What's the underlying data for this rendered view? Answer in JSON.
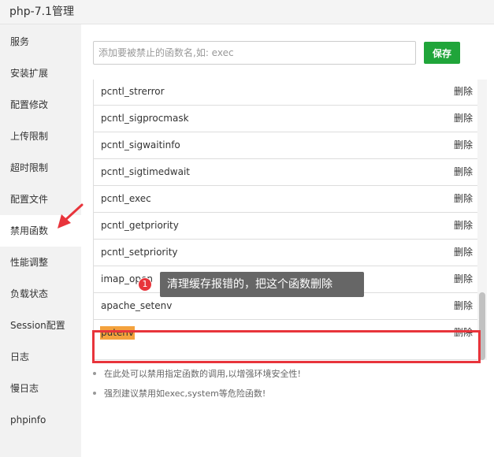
{
  "window": {
    "title": "php-7.1管理"
  },
  "sidebar": {
    "items": [
      {
        "label": "服务"
      },
      {
        "label": "安装扩展"
      },
      {
        "label": "配置修改"
      },
      {
        "label": "上传限制"
      },
      {
        "label": "超时限制"
      },
      {
        "label": "配置文件"
      },
      {
        "label": "禁用函数"
      },
      {
        "label": "性能调整"
      },
      {
        "label": "负载状态"
      },
      {
        "label": "Session配置"
      },
      {
        "label": "日志"
      },
      {
        "label": "慢日志"
      },
      {
        "label": "phpinfo"
      }
    ],
    "active_index": 6
  },
  "toolbar": {
    "input_placeholder": "添加要被禁止的函数名,如: exec",
    "input_value": "",
    "save_label": "保存"
  },
  "functions": {
    "delete_label": "删除",
    "rows": [
      {
        "name": "pcntl_strerror"
      },
      {
        "name": "pcntl_sigprocmask"
      },
      {
        "name": "pcntl_sigwaitinfo"
      },
      {
        "name": "pcntl_sigtimedwait"
      },
      {
        "name": "pcntl_exec"
      },
      {
        "name": "pcntl_getpriority"
      },
      {
        "name": "pcntl_setpriority"
      },
      {
        "name": "imap_open"
      },
      {
        "name": "apache_setenv"
      },
      {
        "name": "putenv"
      }
    ],
    "highlighted_index": 9
  },
  "annotation": {
    "number": "1",
    "text": "清理缓存报错的，把这个函数删除",
    "color": "#e8343b"
  },
  "notes": [
    "在此处可以禁用指定函数的调用,以增强环境安全性!",
    "强烈建议禁用如exec,system等危险函数!"
  ],
  "colors": {
    "accent": "#20a53a",
    "highlight": "#f4a23d",
    "annotation": "#e8343b"
  }
}
